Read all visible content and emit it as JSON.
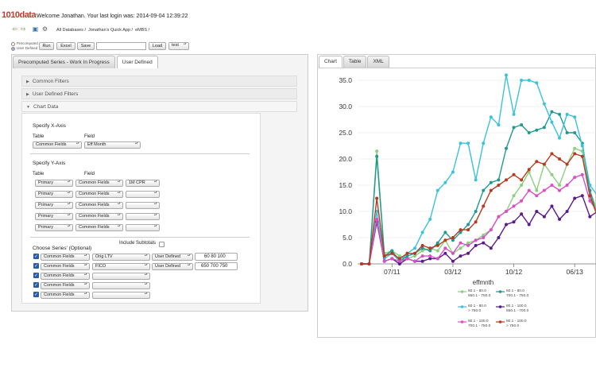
{
  "header": {
    "logo": "1010data",
    "welcome": "Welcome Jonathan.  Your last login was: 2014-09-04 12:39:22"
  },
  "nav": {
    "icons": [
      "back-arrow-icon",
      "forward-arrow-icon",
      "home-icon",
      "tools-icon"
    ],
    "breadcrumbs": [
      "All Databases /",
      "Jonathan's Quick App /",
      "eMBS /"
    ]
  },
  "toolbar": {
    "radio_precomputed": "Precomputed",
    "radio_user_defined": "User Defined",
    "run_label": "Run",
    "excel_label": "Excel",
    "save_label": "Save",
    "save_name_value": "",
    "load_label": "Load",
    "load_select_value": "test"
  },
  "left_tabs": [
    "Precomputed Series - Work In Progress",
    "User Defined"
  ],
  "accordion": {
    "common_filters": "Common Filters",
    "user_defined_filters": "User Defined Filters",
    "chart_data": "Chart Data"
  },
  "x_axis": {
    "heading": "Specify X-Axis",
    "table_label": "Table",
    "field_label": "Field",
    "table_value": "Common Fields",
    "field_value": "Eff Month"
  },
  "y_axis": {
    "heading": "Specify Y-Axis",
    "table_label": "Table",
    "field_label": "Field",
    "rows": [
      {
        "table": "Primary",
        "group": "Common Fields",
        "field": "1M CPR"
      },
      {
        "table": "Primary",
        "group": "Common Fields",
        "field": ""
      },
      {
        "table": "Primary",
        "group": "Common Fields",
        "field": ""
      },
      {
        "table": "Primary",
        "group": "Common Fields",
        "field": ""
      },
      {
        "table": "Primary",
        "group": "Common Fields",
        "field": ""
      }
    ]
  },
  "series": {
    "heading": "Choose Series' (Optional)",
    "include_subtotals": "Include Subtotals",
    "rows": [
      {
        "table": "Common Fields",
        "field": "Orig LTV",
        "type": "User Defined",
        "value": "60 80 100"
      },
      {
        "table": "Common Fields",
        "field": "FICO",
        "type": "User Defined",
        "value": "650 700 750"
      },
      {
        "table": "Common Fields",
        "field": "",
        "type": "",
        "value": ""
      },
      {
        "table": "Common Fields",
        "field": "",
        "type": "",
        "value": ""
      },
      {
        "table": "Common Fields",
        "field": "",
        "type": "",
        "value": ""
      }
    ]
  },
  "right_tabs": [
    "Chart",
    "Table",
    "XML"
  ],
  "colors": {
    "s1": "#8ccf7e",
    "s2": "#1f9a92",
    "s3": "#39c3dc",
    "s4": "#5b1a8c",
    "s5": "#d94fc8",
    "s6": "#b83a1e"
  },
  "chart_data": {
    "type": "line",
    "xlabel": "effmnth",
    "ylabel": "",
    "title": "",
    "ylim": [
      0,
      35
    ],
    "yticks": [
      "0.0",
      "5.0",
      "10.0",
      "15.0",
      "20.0",
      "25.0",
      "30.0",
      "35.0"
    ],
    "xticks": [
      "07/11",
      "03/12",
      "10/12",
      "06/13"
    ],
    "x_tick_positions": [
      4,
      12,
      20,
      28
    ],
    "series": [
      {
        "name": "60.1 - 80.0\n650.1 - 700.0",
        "color": "#8ccf7e",
        "values": [
          0,
          0,
          21.5,
          2,
          2.5,
          1.5,
          1,
          1.5,
          2.5,
          3,
          2.5,
          4.5,
          2,
          3,
          4,
          4.5,
          5.5,
          6.5,
          9,
          10,
          13,
          15,
          17.5,
          14,
          19,
          17,
          15,
          19,
          22,
          21.5,
          14,
          10
        ]
      },
      {
        "name": "60.1 - 80.0\n700.1 - 750.0",
        "color": "#1f9a92",
        "values": [
          0,
          0,
          20.5,
          1.5,
          2.5,
          0.5,
          1.5,
          2,
          3,
          2.5,
          4,
          6,
          4.5,
          6,
          7.5,
          10,
          14,
          15.5,
          16,
          22,
          26,
          26.5,
          25,
          25.5,
          26,
          29,
          28.5,
          25,
          25,
          23,
          14,
          9
        ]
      },
      {
        "name": "60.1 - 80.0\n> 750.0",
        "color": "#39c3dc",
        "values": [
          0,
          0,
          10,
          1,
          2,
          0.5,
          2,
          3,
          6,
          8.5,
          14,
          15.5,
          17.5,
          23,
          23,
          16,
          23,
          28,
          26.5,
          36,
          28.5,
          35,
          35,
          34.5,
          30.5,
          27,
          24,
          28.5,
          28,
          22.5,
          15,
          13
        ]
      },
      {
        "name": "80.1 - 100.0\n650.1 - 700.0",
        "color": "#5b1a8c",
        "values": [
          0,
          0,
          8,
          0.5,
          1,
          0,
          1,
          0.5,
          0.5,
          1,
          1,
          2,
          0.5,
          1.5,
          2,
          3.5,
          4,
          3,
          5,
          7.5,
          8,
          9.5,
          7.5,
          10,
          9,
          11,
          8.5,
          10,
          12.5,
          13,
          9,
          10
        ]
      },
      {
        "name": "80.1 - 100.0\n700.1 - 750.0",
        "color": "#d94fc8",
        "values": [
          0,
          0,
          8.5,
          0.5,
          1,
          0.5,
          1,
          0.5,
          1.5,
          1.5,
          1,
          3,
          2,
          4,
          3.5,
          4.5,
          5,
          6.5,
          9,
          10,
          11,
          12,
          14,
          13,
          14,
          15,
          14,
          15,
          16.5,
          17,
          12,
          10
        ]
      },
      {
        "name": "80.1 - 100.0\n> 750.0",
        "color": "#b83a1e",
        "values": [
          0,
          0,
          12.5,
          1.5,
          2,
          1,
          2,
          2,
          3.5,
          3,
          3.5,
          4.5,
          5,
          6.5,
          6.5,
          8,
          11,
          14,
          15,
          16,
          17,
          16,
          18,
          19.5,
          19,
          21,
          20,
          19,
          21,
          20.5,
          13,
          9
        ]
      }
    ]
  }
}
